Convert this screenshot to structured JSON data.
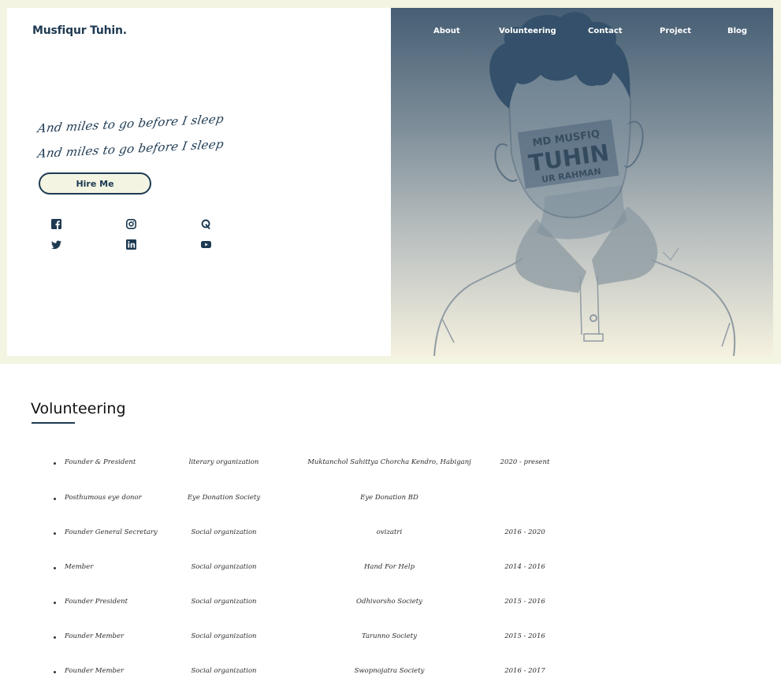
{
  "brand": {
    "name": "Musfiqur Tuhin."
  },
  "nav": {
    "items": [
      {
        "label": "About"
      },
      {
        "label": "Volunteering"
      },
      {
        "label": "Contact"
      },
      {
        "label": "Project"
      },
      {
        "label": "Blog"
      }
    ]
  },
  "hero": {
    "tagline_1": "And miles to go before I sleep",
    "tagline_2": "And miles to go before I sleep",
    "hire_label": "Hire Me",
    "portrait_stamp": [
      "MD MUSFIQ",
      "TUHIN",
      "UR RAHMAN"
    ]
  },
  "social": [
    {
      "icon": "facebook-icon"
    },
    {
      "icon": "instagram-icon"
    },
    {
      "icon": "quora-icon"
    },
    {
      "icon": "twitter-icon"
    },
    {
      "icon": "linkedin-icon"
    },
    {
      "icon": "youtube-icon"
    }
  ],
  "volunteering": {
    "title": "Volunteering",
    "rows": [
      {
        "role": "Founder & President",
        "type": "literary organization",
        "org": "Muktanchol Sahittya Chorcha Kendro, Habiganj",
        "years": "2020 - present"
      },
      {
        "role": "Posthumous eye donor",
        "type": "Eye Donation Society",
        "org": "Eye Donation BD",
        "years": ""
      },
      {
        "role": "Founder General Secretary",
        "type": "Social organization",
        "org": "ovizatri",
        "years": "2016 - 2020"
      },
      {
        "role": "Member",
        "type": "Social organization",
        "org": "Hand For Help",
        "years": "2014 - 2016"
      },
      {
        "role": "Founder President",
        "type": "Social organization",
        "org": "Odhivorsho Society",
        "years": "2015 - 2016"
      },
      {
        "role": "Founder Member",
        "type": "Social organization",
        "org": "Tarunno Society",
        "years": "2015 - 2016"
      },
      {
        "role": "Founder Member",
        "type": "Social organization",
        "org": "Swopnojatra Society",
        "years": "2016 - 2017"
      }
    ]
  },
  "colors": {
    "accent": "#1e3a52",
    "frame": "#f3f4e2",
    "button_fill": "#f3f4e2"
  }
}
